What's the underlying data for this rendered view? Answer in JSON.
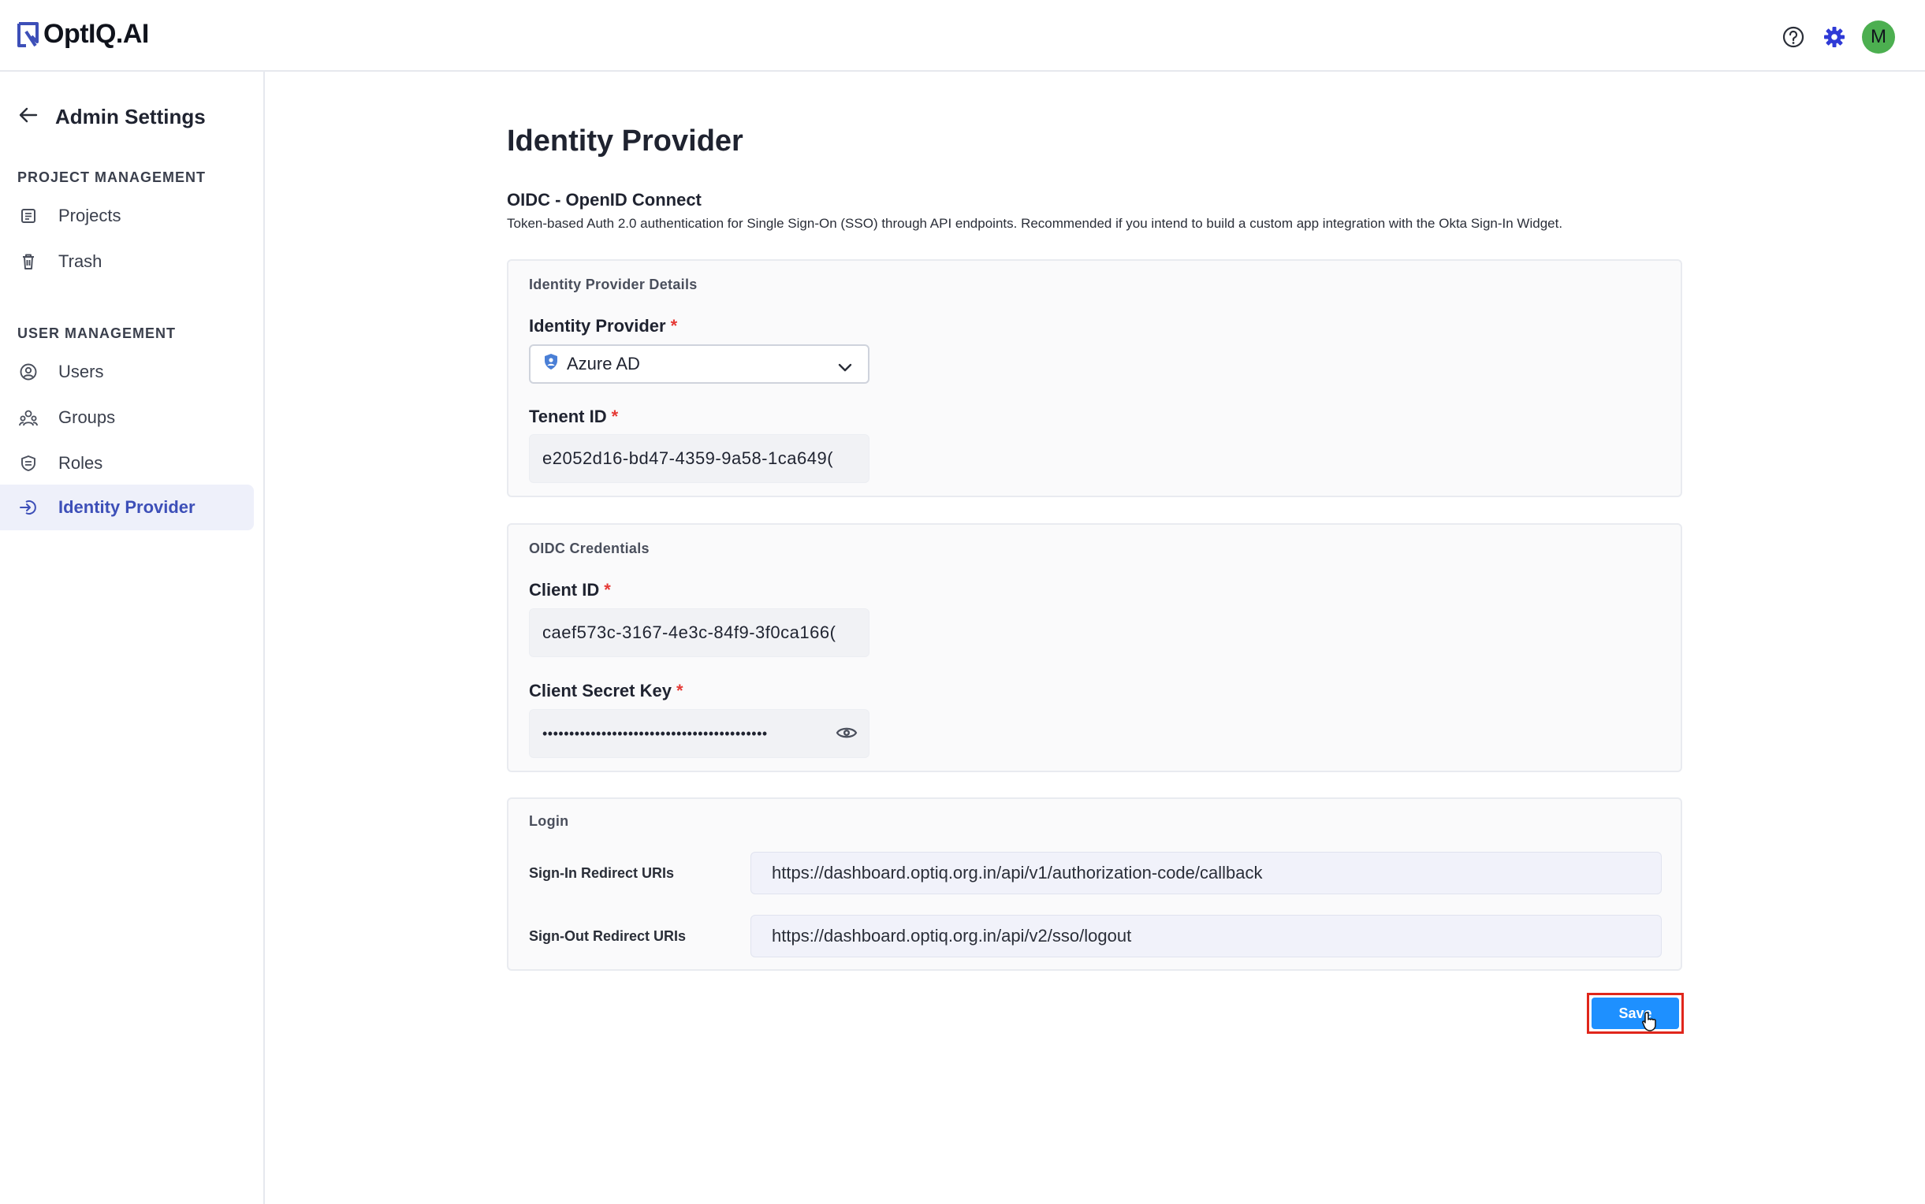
{
  "app": {
    "logo_text": "OptIQ.AI",
    "brand_color": "#3d4fb8",
    "avatar_initial": "M",
    "avatar_color": "#4caf50",
    "icons": [
      "help-icon",
      "settings-gear-icon"
    ]
  },
  "sidebar": {
    "back_title": "Admin Settings",
    "sections": [
      {
        "label": "PROJECT MANAGEMENT",
        "items": [
          {
            "label": "Projects",
            "icon": "projects-icon"
          },
          {
            "label": "Trash",
            "icon": "trash-icon"
          }
        ]
      },
      {
        "label": "USER MANAGEMENT",
        "items": [
          {
            "label": "Users",
            "icon": "users-icon"
          },
          {
            "label": "Groups",
            "icon": "groups-icon"
          },
          {
            "label": "Roles",
            "icon": "roles-icon"
          },
          {
            "label": "Identity Provider",
            "icon": "identity-provider-icon",
            "active": true
          }
        ]
      }
    ]
  },
  "main": {
    "page_title": "Identity Provider",
    "oidc_title": "OIDC - OpenID Connect",
    "oidc_description": "Token-based Auth 2.0 authentication for Single Sign-On (SSO) through API endpoints. Recommended if you intend to build a custom app integration with the Okta Sign-In Widget.",
    "details_card": {
      "title": "Identity Provider Details",
      "provider_label": "Identity Provider",
      "provider_value": "Azure AD",
      "tenant_label": "Tenent ID",
      "tenant_value": "e2052d16-bd47-4359-9a58-1ca649("
    },
    "credentials_card": {
      "title": "OIDC Credentials",
      "client_id_label": "Client ID",
      "client_id_value": "caef573c-3167-4e3c-84f9-3f0ca166(",
      "secret_label": "Client Secret Key",
      "secret_value": "••••••••••••••••••••••••••••••••••••••••••"
    },
    "login_card": {
      "title": "Login",
      "signin_label": "Sign-In Redirect URIs",
      "signin_value": "https://dashboard.optiq.org.in/api/v1/authorization-code/callback",
      "signout_label": "Sign-Out Redirect URIs",
      "signout_value": "https://dashboard.optiq.org.in/api/v2/sso/logout"
    },
    "required_marker": "*",
    "save_label": "Save",
    "save_color": "#1e90ff",
    "highlight_color": "#e0261b"
  }
}
